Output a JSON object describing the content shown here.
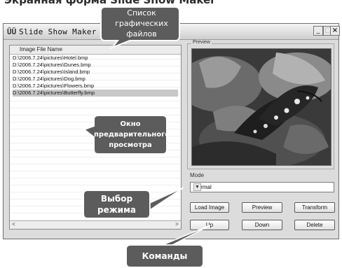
{
  "page_heading": "Экранная форма Slide Show Maker",
  "window": {
    "app_icon": "ŬŬ",
    "title": "Slide Show Maker V1.12 B",
    "minimize": "_",
    "maximize": "□",
    "close": "×"
  },
  "file_list": {
    "column_header": "Image File Name",
    "rows": [
      "D:\\2006.7.24\\pictures\\Hotel.bmp",
      "D:\\2006.7.24\\pictures\\Dunes.bmp",
      "D:\\2006.7.24\\pictures\\Island.bmp",
      "D:\\2006.7.24\\pictures\\Dog.bmp",
      "D:\\2006.7.24\\pictures\\Flowers.bmp",
      "D:\\2006.7.24\\pictures\\Butterfly.bmp"
    ],
    "selected_index": 5,
    "scroll_left": "<",
    "scroll_right": ">"
  },
  "preview": {
    "label": "Preview"
  },
  "mode": {
    "label": "Mode",
    "value": "Normal"
  },
  "buttons": {
    "load_image": "Load Image",
    "preview": "Preview",
    "transform": "Transform",
    "up": "Up",
    "down": "Down",
    "delete": "Delete"
  },
  "callouts": {
    "file_list": [
      "Список",
      "графических",
      "файлов"
    ],
    "preview_window": [
      "Окно",
      "предварительного",
      "просмотра"
    ],
    "mode_select": [
      "Выбор",
      "режима"
    ],
    "commands": "Команды"
  },
  "colors": {
    "callout_fill": "#5c5c5c",
    "callout_stroke": "#ffffff",
    "window_bg": "#dcdcdc"
  }
}
